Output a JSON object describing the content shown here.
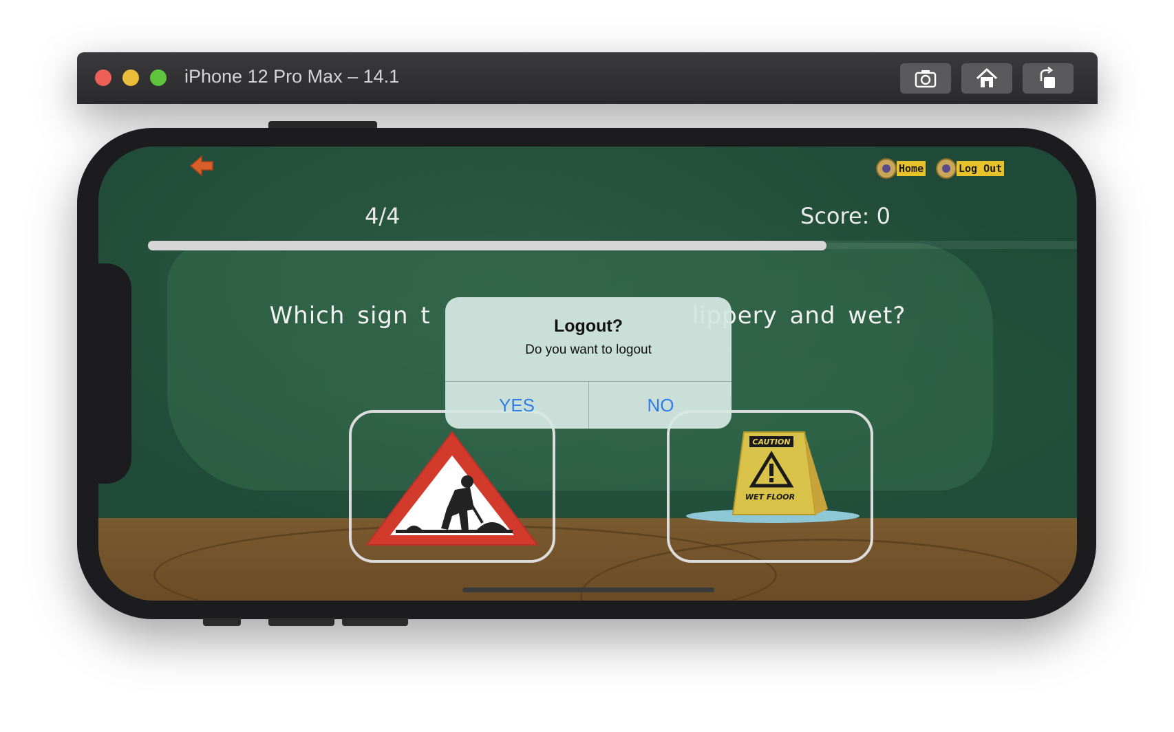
{
  "window": {
    "title": "iPhone 12 Pro Max – 14.1",
    "toolbar_icons": [
      "screenshot-icon",
      "home-icon",
      "rotate-icon"
    ]
  },
  "app": {
    "nav": {
      "home_label": "Home",
      "logout_label": "Log Out"
    },
    "counter": "4/4",
    "score": "Score: 0",
    "progress_fraction": 0.72,
    "question_left": "Which sign t",
    "question_right": "lippery and wet?",
    "options": [
      {
        "icon": "road-works-sign-icon"
      },
      {
        "icon": "wet-floor-sign-icon",
        "sign_top": "CAUTION",
        "sign_bottom": "WET FLOOR"
      }
    ]
  },
  "alert": {
    "title": "Logout?",
    "message": "Do you want to logout",
    "yes_label": "YES",
    "no_label": "NO"
  },
  "colors": {
    "board": "#1f4a38",
    "floor": "#7a5a2f",
    "alert_button": "#2f7ee8",
    "nav_label": "#e8c22a"
  }
}
